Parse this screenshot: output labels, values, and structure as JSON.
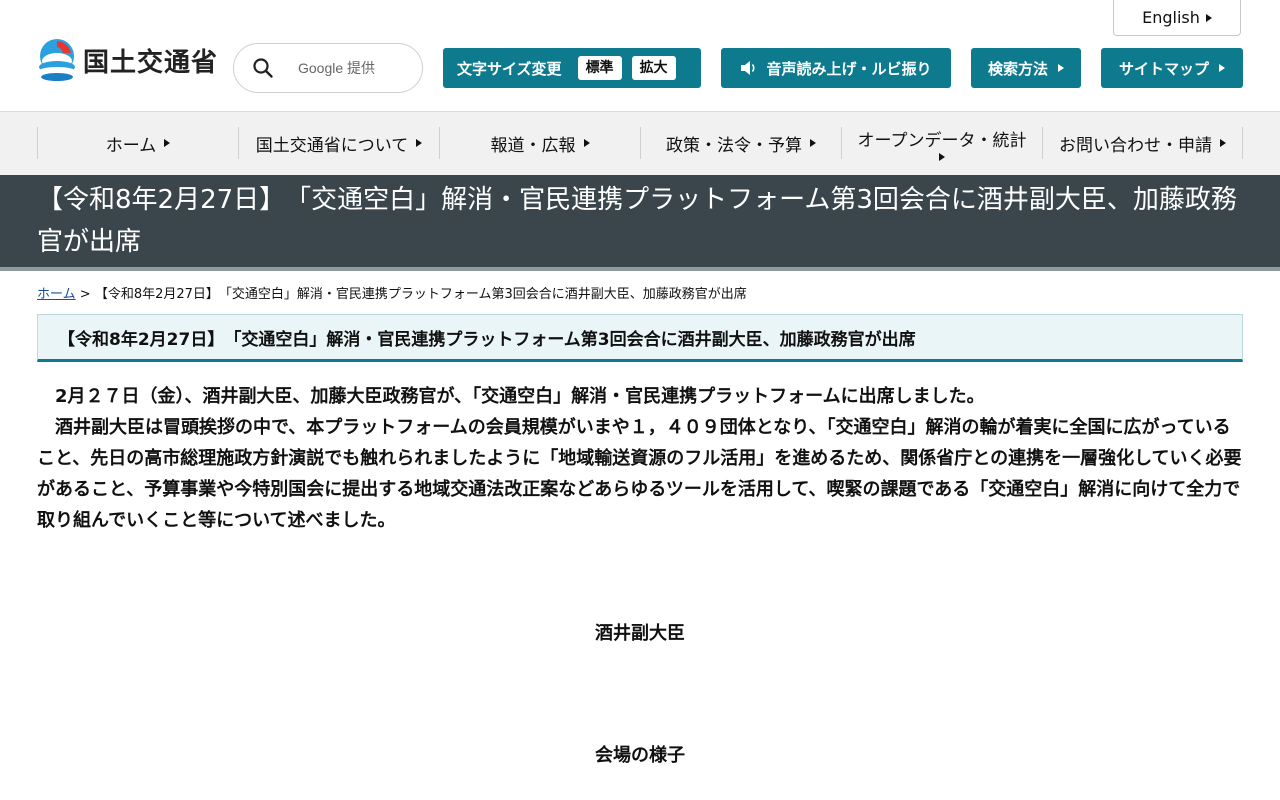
{
  "header": {
    "english": "English",
    "logo_text": "国土交通省",
    "search": {
      "placeholder": "Google 提供"
    },
    "fontsize": {
      "label": "文字サイズ変更",
      "standard": "標準",
      "large": "拡大"
    },
    "voice": "音声読み上げ・ルビ振り",
    "search_method": "検索方法",
    "sitemap": "サイトマップ"
  },
  "nav": [
    {
      "label": "ホーム"
    },
    {
      "label": "国土交通省について"
    },
    {
      "label": "報道・広報"
    },
    {
      "label": "政策・法令・予算"
    },
    {
      "label": "オープンデータ・統計"
    },
    {
      "label": "お問い合わせ・申請"
    }
  ],
  "page_title": "【令和8年2月27日】　「交通空白」解消・官民連携プラットフォーム第3回会合に酒井副大臣、加藤政務官が出席",
  "breadcrumb": {
    "home": "ホーム",
    "separator": ">",
    "current": "【令和8年2月27日】　「交通空白」解消・官民連携プラットフォーム第3回会合に酒井副大臣、加藤政務官が出席"
  },
  "article": {
    "heading": "【令和8年2月27日】　「交通空白」解消・官民連携プラットフォーム第3回会合に酒井副大臣、加藤政務官が出席",
    "paragraphs": [
      "2月２７日（金）、酒井副大臣、加藤大臣政務官が、「交通空白」解消・官民連携プラットフォームに出席しました。",
      "酒井副大臣は冒頭挨拶の中で、本プラットフォームの会員規模がいまや１，４０９団体となり、「交通空白」解消の輪が着実に全国に広がっていること、先日の高市総理施政方針演説でも触れられましたように「地域輸送資源のフル活用」を進めるため、関係省庁との連携を一層強化していく必要があること、予算事業や今特別国会に提出する地域交通法改正案などあらゆるツールを活用して、喫緊の課題である「交通空白」解消に向けて全力で取り組んでいくこと等について述べました。"
    ],
    "captions": [
      "酒井副大臣",
      "会場の様子"
    ]
  },
  "colors": {
    "accent": "#0d7a8e",
    "title_band": "#3a464b",
    "nav_bg": "#f1f1f1",
    "heading_bg": "#eaf5f8"
  }
}
